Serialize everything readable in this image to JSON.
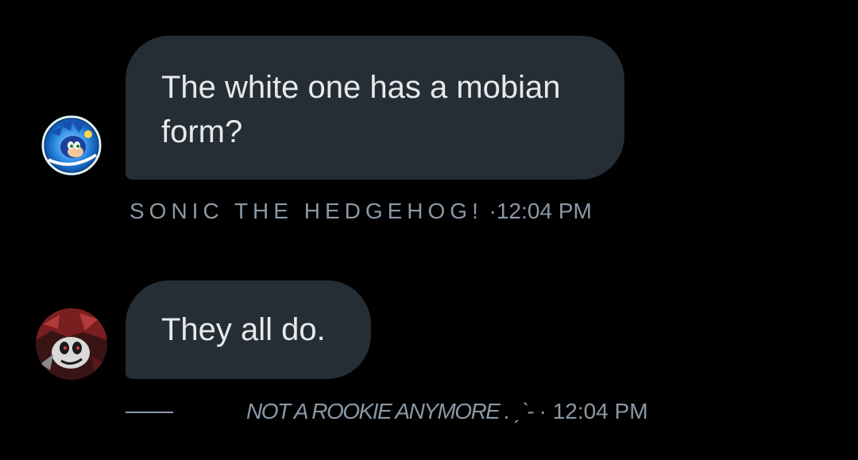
{
  "messages": [
    {
      "text": "The white one has a mobian form?",
      "sender": "SONIC THE HEDGEHOG!",
      "separator": "·",
      "time": "12:04 PM",
      "avatar_icon": "sonic-avatar-icon"
    },
    {
      "text": "They all do.",
      "sender": "NOT A ROOKIE ANYMORE . ˏˋ-",
      "separator": "·",
      "time": "12:04 PM",
      "avatar_icon": "red-character-avatar-icon"
    }
  ],
  "colors": {
    "background": "#000000",
    "bubble": "#252d35",
    "text": "#e7e9ea",
    "meta": "#8b98a5"
  }
}
